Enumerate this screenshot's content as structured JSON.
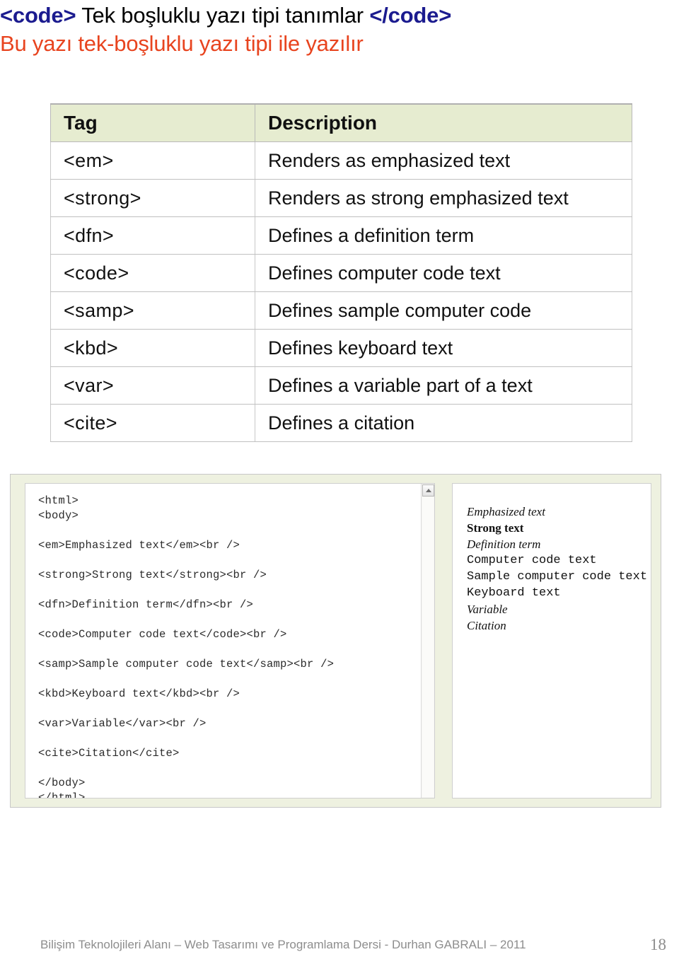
{
  "heading": {
    "line1_open_tag": "<code>",
    "line1_middle": " Tek boşluklu yazı tipi tanımlar ",
    "line1_close_tag": "</code>",
    "line2": "Bu yazı tek-boşluklu yazı tipi ile yazılır",
    "tag_color": "#1b1b8f",
    "line2_color": "#e8441f"
  },
  "tag_table": {
    "header_background": "#e6ecd0",
    "columns": [
      "Tag",
      "Description"
    ],
    "rows": [
      {
        "tag": "<em>",
        "description": "Renders as emphasized text"
      },
      {
        "tag": "<strong>",
        "description": "Renders as strong emphasized text"
      },
      {
        "tag": "<dfn>",
        "description": "Defines a definition term"
      },
      {
        "tag": "<code>",
        "description": "Defines computer code text"
      },
      {
        "tag": "<samp>",
        "description": "Defines sample computer code"
      },
      {
        "tag": "<kbd>",
        "description": "Defines keyboard text"
      },
      {
        "tag": "<var>",
        "description": "Defines a variable part of a text"
      },
      {
        "tag": "<cite>",
        "description": "Defines a citation"
      }
    ]
  },
  "editor": {
    "background": "#eef1e0",
    "code": "<html>\n<body>\n\n<em>Emphasized text</em><br />\n\n<strong>Strong text</strong><br />\n\n<dfn>Definition term</dfn><br />\n\n<code>Computer code text</code><br />\n\n<samp>Sample computer code text</samp><br />\n\n<kbd>Keyboard text</kbd><br />\n\n<var>Variable</var><br />\n\n<cite>Citation</cite>\n\n</body>\n</html>",
    "scrollbar": {
      "up_arrow": "chevron-up-icon"
    },
    "preview": [
      {
        "text": "Emphasized text",
        "style": "pv-em"
      },
      {
        "text": "Strong text",
        "style": "pv-strong"
      },
      {
        "text": "Definition term",
        "style": "pv-dfn"
      },
      {
        "text": "Computer code text",
        "style": "pv-code"
      },
      {
        "text": "Sample computer code text",
        "style": "pv-samp"
      },
      {
        "text": "Keyboard text",
        "style": "pv-kbd"
      },
      {
        "text": "Variable",
        "style": "pv-var"
      },
      {
        "text": "Citation",
        "style": "pv-cite"
      }
    ]
  },
  "footer": {
    "text": "Bilişim Teknolojileri Alanı – Web Tasarımı ve Programlama Dersi -  Durhan GABRALI – 2011",
    "page_number": "18"
  }
}
